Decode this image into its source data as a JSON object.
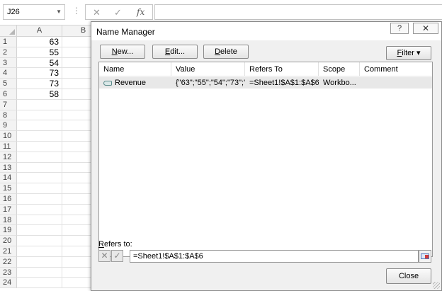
{
  "formula_bar": {
    "name_box": "J26",
    "cancel_glyph": "✕",
    "enter_glyph": "✓",
    "fx_label": "fx",
    "formula": ""
  },
  "sheet": {
    "columns": [
      "A",
      "B"
    ],
    "rows": [
      {
        "num": "1",
        "a": "63"
      },
      {
        "num": "2",
        "a": "55"
      },
      {
        "num": "3",
        "a": "54"
      },
      {
        "num": "4",
        "a": "73"
      },
      {
        "num": "5",
        "a": "73"
      },
      {
        "num": "6",
        "a": "58"
      },
      {
        "num": "7",
        "a": ""
      },
      {
        "num": "8",
        "a": ""
      },
      {
        "num": "9",
        "a": ""
      },
      {
        "num": "10",
        "a": ""
      },
      {
        "num": "11",
        "a": ""
      },
      {
        "num": "12",
        "a": ""
      },
      {
        "num": "13",
        "a": ""
      },
      {
        "num": "14",
        "a": ""
      },
      {
        "num": "15",
        "a": ""
      },
      {
        "num": "16",
        "a": ""
      },
      {
        "num": "17",
        "a": ""
      },
      {
        "num": "18",
        "a": ""
      },
      {
        "num": "19",
        "a": ""
      },
      {
        "num": "20",
        "a": ""
      },
      {
        "num": "21",
        "a": ""
      },
      {
        "num": "22",
        "a": ""
      },
      {
        "num": "23",
        "a": ""
      },
      {
        "num": "24",
        "a": ""
      }
    ]
  },
  "dialog": {
    "title": "Name Manager",
    "help_label": "?",
    "close_glyph": "✕",
    "buttons": {
      "new": {
        "accel": "N",
        "rest": "ew..."
      },
      "edit": {
        "accel": "E",
        "rest": "dit..."
      },
      "delete": {
        "accel": "D",
        "rest": "elete"
      },
      "filter": {
        "accel": "F",
        "rest": "ilter ▾"
      },
      "close": "Close"
    },
    "list": {
      "headers": [
        "Name",
        "Value",
        "Refers To",
        "Scope",
        "Comment"
      ],
      "rows": [
        {
          "name": "Revenue",
          "value": "{\"63\";\"55\";\"54\";\"73\";\"...",
          "refers_to": "=Sheet1!$A$1:$A$6",
          "scope": "Workbo...",
          "comment": ""
        }
      ]
    },
    "refers_to": {
      "label_accel": "R",
      "label_rest": "efers to:",
      "value": "=Sheet1!$A$1:$A$6"
    }
  }
}
